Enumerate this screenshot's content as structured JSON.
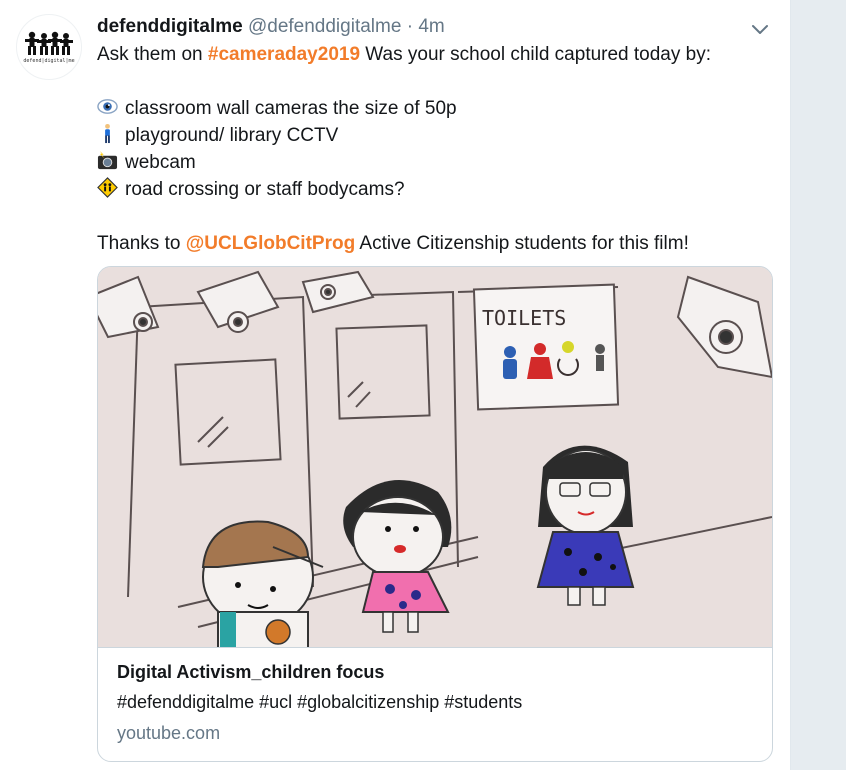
{
  "tweet": {
    "display_name": "defenddigitalme",
    "handle": "@defenddigitalme",
    "separator": "·",
    "time": "4m",
    "avatar_caption": "defend|digital|me",
    "line1_prefix": "Ask them on ",
    "line1_hashtag": "#cameraday2019",
    "line1_suffix": " Was your school child captured today by:",
    "items": [
      {
        "icon": "eye-emoji",
        "text": "classroom wall cameras the size of 50p"
      },
      {
        "icon": "person-emoji",
        "text": "playground/ library CCTV"
      },
      {
        "icon": "camera-flash-emoji",
        "text": "webcam"
      },
      {
        "icon": "children-crossing-emoji",
        "text": "road crossing or staff bodycams?"
      }
    ],
    "thanks_prefix": "Thanks to ",
    "thanks_mention": "@UCLGlobCitProg",
    "thanks_suffix": " Active Citizenship students for this film!"
  },
  "card": {
    "image_sign_text": "TOILETS",
    "title": "Digital Activism_children focus",
    "description": "#defenddigitalme #ucl #globalcitizenship #students",
    "domain": "youtube.com"
  },
  "colors": {
    "accent": "#f27c2a",
    "secondary_text": "#657786",
    "border": "#ccd6dd"
  }
}
